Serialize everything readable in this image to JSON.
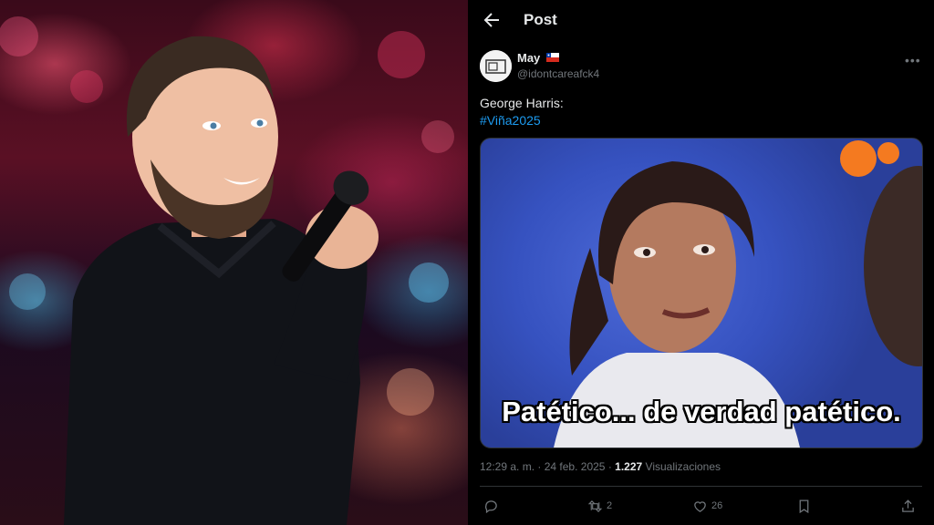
{
  "post_header": {
    "title": "Post"
  },
  "author": {
    "name": "May",
    "handle": "@idontcareafck4"
  },
  "tweet": {
    "text": "George Harris:",
    "hashtag": "#Viña2025"
  },
  "media": {
    "caption": "Patético... de verdad patético."
  },
  "meta": {
    "time": "12:29 a. m.",
    "separator": "·",
    "date": "24 feb. 2025",
    "views_count": "1.227",
    "views_label": "Visualizaciones"
  },
  "actions": {
    "retweets": "2",
    "likes": "26"
  },
  "colors": {
    "accent": "#1d9bf0",
    "text": "#e7e9ea",
    "muted": "#71767b",
    "background": "#000000"
  },
  "icons": [
    "back-arrow-icon",
    "chile-flag-icon",
    "more-icon",
    "reply-icon",
    "retweet-icon",
    "like-icon",
    "bookmark-icon",
    "share-icon"
  ]
}
